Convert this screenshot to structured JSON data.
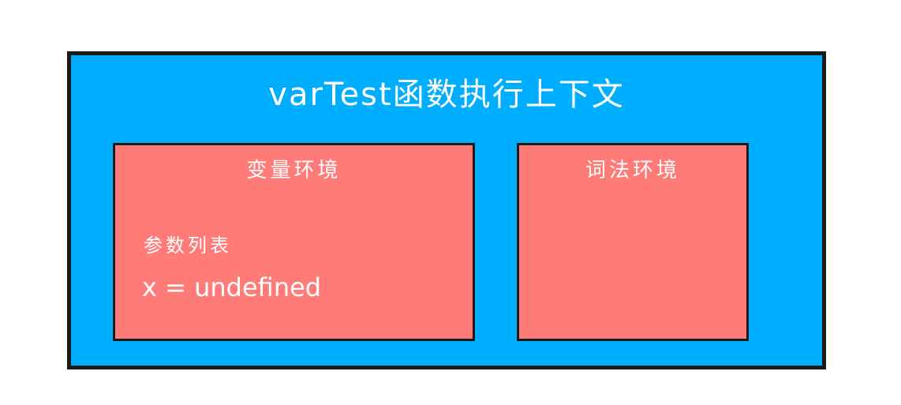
{
  "context": {
    "title": "varTest函数执行上下文",
    "variable_env": {
      "title": "变量环境",
      "param_label": "参数列表",
      "param_value": "x = undefined"
    },
    "lexical_env": {
      "title": "词法环境"
    }
  },
  "colors": {
    "context_fill": "#00AEFF",
    "env_fill": "#FF7B78",
    "border": "#1a1a1a",
    "text": "#ffffff"
  }
}
